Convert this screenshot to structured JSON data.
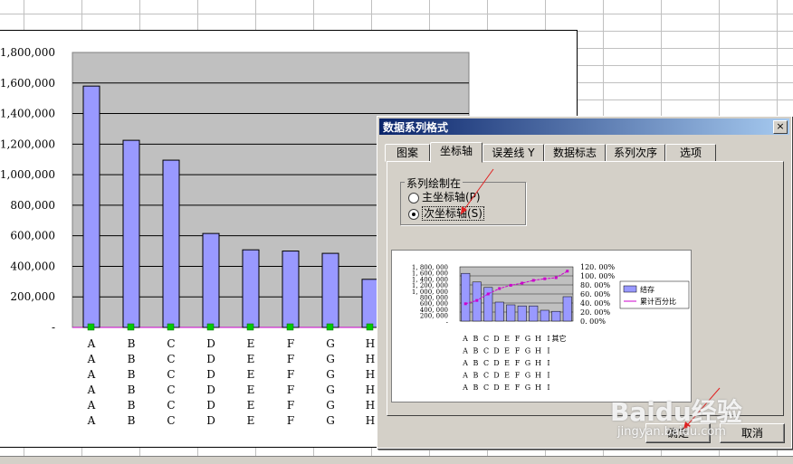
{
  "chart": {
    "y_ticks": [
      "1,800,000",
      "1,600,000",
      "1,400,000",
      "1,200,000",
      "1,000,000",
      "800,000",
      "600,000",
      "400,000",
      "200,000",
      "-"
    ],
    "rows": [
      [
        "A",
        "B",
        "C",
        "D",
        "E",
        "F",
        "G",
        "H"
      ],
      [
        "A",
        "B",
        "C",
        "D",
        "E",
        "F",
        "G",
        "H"
      ],
      [
        "A",
        "B",
        "C",
        "D",
        "E",
        "F",
        "G",
        "H"
      ],
      [
        "A",
        "B",
        "C",
        "D",
        "E",
        "F",
        "G",
        "H"
      ],
      [
        "A",
        "B",
        "C",
        "D",
        "E",
        "F",
        "G",
        "H"
      ],
      [
        "A",
        "B",
        "C",
        "D",
        "E",
        "F",
        "G",
        "H"
      ]
    ]
  },
  "chart_data": {
    "type": "bar",
    "categories": [
      "A",
      "B",
      "C",
      "D",
      "E",
      "F",
      "G",
      "H"
    ],
    "values": [
      1580000,
      1225000,
      1095000,
      615000,
      508000,
      500000,
      485000,
      315000
    ],
    "ylim": [
      0,
      1800000
    ],
    "grid": true,
    "bar_color": "#9999ff",
    "plot_bg": "#c0c0c0",
    "marker_color": "#00cc00",
    "line_color": "#cc00cc"
  },
  "dialog": {
    "title": "数据系列格式",
    "close": "×",
    "tabs": [
      "图案",
      "坐标轴",
      "误差线 Y",
      "数据标志",
      "系列次序",
      "选项"
    ],
    "active_tab": 1,
    "group_label": "系列绘制在",
    "radio_primary": "主坐标轴(P)",
    "radio_secondary": "次坐标轴(S)",
    "ok": "确定",
    "cancel": "取消"
  },
  "preview": {
    "left_ticks": [
      "1, 800, 000",
      "1, 600, 000",
      "1, 400, 000",
      "1, 200, 000",
      "1, 000, 000",
      "800, 000",
      "600, 000",
      "400, 000",
      "200, 000",
      "-"
    ],
    "right_ticks": [
      "120. 00%",
      "100. 00%",
      "80. 00%",
      "60. 00%",
      "40. 00%",
      "20. 00%",
      "0. 00%"
    ],
    "legend": [
      "结存",
      "累计百分比"
    ],
    "category_rows": [
      [
        "A",
        "B",
        "C",
        "D",
        "E",
        "F",
        "G",
        "H",
        "I",
        "其它"
      ],
      [
        "A",
        "B",
        "C",
        "D",
        "E",
        "F",
        "G",
        "H",
        "I"
      ],
      [
        "A",
        "B",
        "C",
        "D",
        "E",
        "F",
        "G",
        "H",
        "I"
      ],
      [
        "A",
        "B",
        "C",
        "D",
        "E",
        "F",
        "G",
        "H",
        "I"
      ],
      [
        "A",
        "B",
        "C",
        "D",
        "E",
        "F",
        "G",
        "H",
        "I"
      ]
    ],
    "bar_values": [
      0.88,
      0.72,
      0.62,
      0.35,
      0.3,
      0.28,
      0.28,
      0.2,
      0.18,
      0.45
    ],
    "line_values": [
      0.32,
      0.38,
      0.5,
      0.6,
      0.66,
      0.7,
      0.75,
      0.78,
      0.8,
      0.92
    ]
  },
  "watermark": {
    "logo": "Baidu经验",
    "url": "jingyan.baidu.com"
  }
}
